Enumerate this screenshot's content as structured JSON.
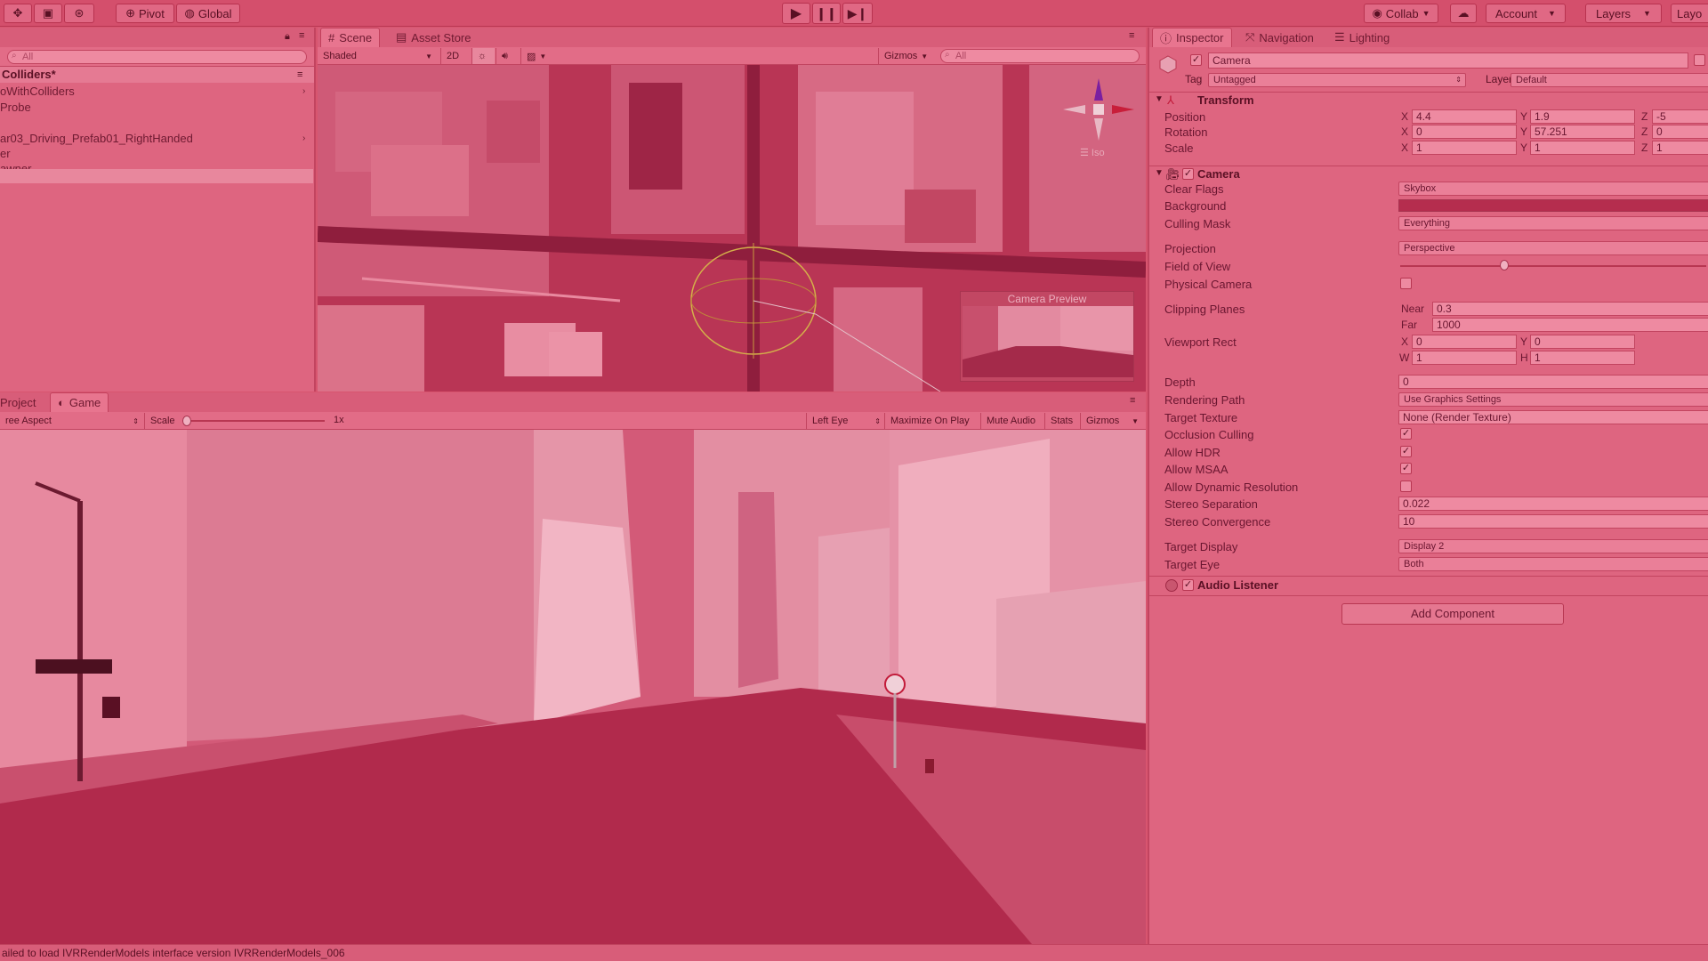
{
  "toolbar": {
    "pivot_label": "Pivot",
    "global_label": "Global",
    "collab_label": "Collab",
    "account_label": "Account",
    "layers_label": "Layers",
    "layout_label": "Layo"
  },
  "hierarchy": {
    "search_placeholder": "All",
    "scene_title": "Colliders*",
    "items": [
      "oWithColliders",
      " Probe",
      "",
      "ar03_Driving_Prefab01_RightHanded",
      "er",
      "awner"
    ]
  },
  "scene": {
    "tabs": {
      "scene": "Scene",
      "asset_store": "Asset Store"
    },
    "shading": "Shaded",
    "mode_2d": "2D",
    "gizmos": "Gizmos",
    "search_placeholder": "All",
    "gizmo_view": "Iso",
    "camera_preview_title": "Camera Preview"
  },
  "game": {
    "tabs": {
      "project": "Project",
      "game": "Game"
    },
    "aspect": "ree Aspect",
    "scale_label": "Scale",
    "scale_value": "1x",
    "scale_fraction": 0.0,
    "buttons": [
      "Left Eye",
      "Maximize On Play",
      "Mute Audio",
      "Stats",
      "Gizmos"
    ]
  },
  "inspector": {
    "tabs": {
      "inspector": "Inspector",
      "navigation": "Navigation",
      "lighting": "Lighting"
    },
    "object_name": "Camera",
    "tag_label": "Tag",
    "tag_value": "Untagged",
    "layer_label": "Layer",
    "layer_value": "Default",
    "transform": {
      "title": "Transform",
      "rows": [
        {
          "label": "Position",
          "x": "4.4",
          "y": "1.9",
          "z": "-5"
        },
        {
          "label": "Rotation",
          "x": "0",
          "y": "57.251",
          "z": "0"
        },
        {
          "label": "Scale",
          "x": "1",
          "y": "1",
          "z": "1"
        }
      ]
    },
    "camera": {
      "title": "Camera",
      "clear_flags_label": "Clear Flags",
      "clear_flags_value": "Skybox",
      "background_label": "Background",
      "background_color": "#b52d4e",
      "culling_mask_label": "Culling Mask",
      "culling_mask_value": "Everything",
      "projection_label": "Projection",
      "projection_value": "Perspective",
      "fov_label": "Field of View",
      "fov_fraction": 0.34,
      "physical_camera_label": "Physical Camera",
      "clipping_label": "Clipping Planes",
      "near_label": "Near",
      "near_value": "0.3",
      "far_label": "Far",
      "far_value": "1000",
      "viewport_label": "Viewport Rect",
      "vx": "0",
      "vy": "0",
      "vw": "1",
      "vh": "1",
      "depth_label": "Depth",
      "depth_value": "0",
      "rendering_path_label": "Rendering Path",
      "rendering_path_value": "Use Graphics Settings",
      "target_texture_label": "Target Texture",
      "target_texture_value": "None (Render Texture)",
      "occlusion_label": "Occlusion Culling",
      "hdr_label": "Allow HDR",
      "msaa_label": "Allow MSAA",
      "dynres_label": "Allow Dynamic Resolution",
      "stereo_sep_label": "Stereo Separation",
      "stereo_sep_value": "0.022",
      "stereo_conv_label": "Stereo Convergence",
      "stereo_conv_value": "10",
      "target_display_label": "Target Display",
      "target_display_value": "Display 2",
      "target_eye_label": "Target Eye",
      "target_eye_value": "Both"
    },
    "audio_listener_title": "Audio Listener",
    "add_component_label": "Add Component"
  },
  "status_bar": {
    "message": "ailed to load IVRRenderModels interface version IVRRenderModels_006"
  },
  "colors": {
    "tint": "#d8556f",
    "panel": "#de6580",
    "toolbar": "#d44f6c"
  }
}
